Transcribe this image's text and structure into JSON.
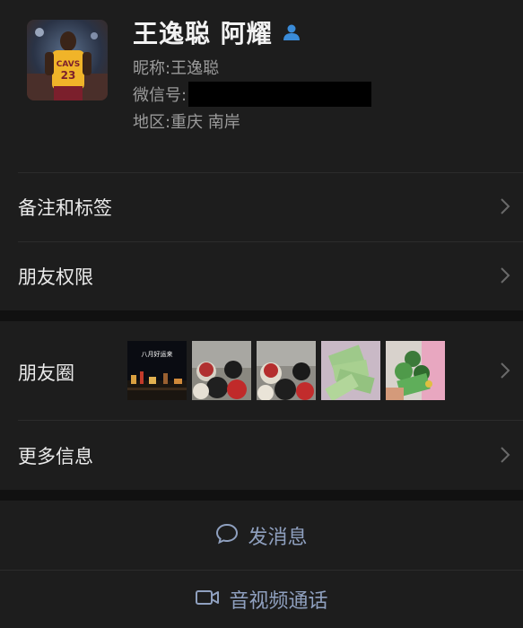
{
  "profile": {
    "name": "王逸聪 阿耀",
    "nickname_label": "昵称:",
    "nickname": "王逸聪",
    "wechat_id_label": "微信号:",
    "region_label": "地区:",
    "region": "重庆 南岸",
    "avatar_jersey_text": "CAVS",
    "avatar_number": "23"
  },
  "menu": {
    "remarks_tags": "备注和标签",
    "friend_permissions": "朋友权限",
    "moments": "朋友圈",
    "more_info": "更多信息"
  },
  "moments": {
    "thumb1_caption": "八月好运来"
  },
  "actions": {
    "message": "发消息",
    "video_call": "音视频通话"
  },
  "icons": {
    "vip": "person-badge-icon",
    "chevron": "chevron-right-icon",
    "message": "chat-bubble-icon",
    "video": "video-camera-icon"
  },
  "colors": {
    "background": "#111111",
    "card": "#1d1d1d",
    "action_text": "#8fa0bf",
    "badge": "#3a8bd8"
  }
}
